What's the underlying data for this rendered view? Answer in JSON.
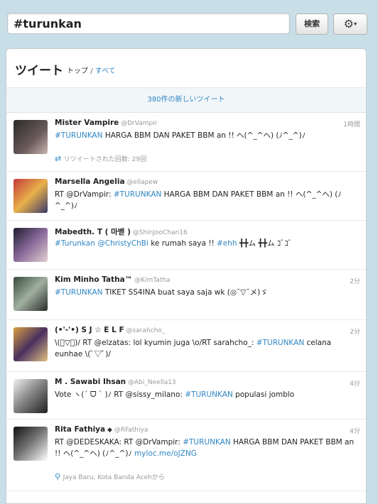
{
  "search": {
    "query": "#turunkan",
    "button_label": "検索",
    "gear": "⚙"
  },
  "panel": {
    "title": "ツイート",
    "tab_top": "トップ",
    "tab_separator": "/",
    "tab_all": "すべて",
    "new_tweets": "380件の新しいツイート"
  },
  "tweets": [
    {
      "name": "Mister Vampire",
      "handle": "@DrVampir",
      "time": "1時間",
      "parts": [
        [
          "#TURUNKAN",
          "hl"
        ],
        [
          " HARGA BBM DAN PAKET BBM an !! ヘ(^_^ヘ) (ﾉ^_^)ﾉ",
          ""
        ]
      ],
      "meta": "リツイートされた回数: 29回",
      "meta_icon": "retweet-icon"
    },
    {
      "name": "Marsella Angelia",
      "handle": "@ellapew",
      "time": "",
      "parts": [
        [
          "RT ",
          ""
        ],
        [
          "@DrVampir",
          ""
        ],
        [
          ": ",
          ""
        ],
        [
          "#TURUNKAN",
          "hl"
        ],
        [
          " HARGA BBM DAN PAKET BBM an !! ヘ(^_^ヘ) (ﾉ^_^)ﾉ",
          ""
        ]
      ]
    },
    {
      "name": "Mabedth. T ( 마벧 )",
      "handle": "@ShinJooChan16",
      "time": "",
      "parts": [
        [
          "#Turunkan",
          "hl"
        ],
        [
          " ",
          ""
        ],
        [
          "@ChristyChBi",
          "hl"
        ],
        [
          " ke rumah saya !! ",
          ""
        ],
        [
          "#ehh",
          "hl"
        ],
        [
          " ╋╋ム ╋╋ム ｺﾞｺﾞ",
          ""
        ]
      ]
    },
    {
      "name": "Kim Minho Tatha™",
      "handle": "@KimTatha",
      "time": "2分",
      "parts": [
        [
          "#TURUNKAN",
          "hl"
        ],
        [
          " TIKET SS4INA buat saya saja wk (◎¯▽¯メ)ゞ",
          ""
        ]
      ]
    },
    {
      "name": "(•'-'•) S J ☆ E L F",
      "handle": "@sarahcho_",
      "time": "2分",
      "parts": [
        [
          "\\(ﾟ▽ﾟ)/ RT ",
          ""
        ],
        [
          "@elzatas",
          ""
        ],
        [
          ": lol kyumin juga \\o/RT sarahcho_: ",
          ""
        ],
        [
          "#TURUNKAN",
          "hl"
        ],
        [
          " celana eunhae \\(ﾟ▽ﾟ)/",
          ""
        ]
      ]
    },
    {
      "name": "M . Sawabi Ihsan",
      "handle": "@Abi_Neella13",
      "time": "4分",
      "parts": [
        [
          "Vote ヽ(´ ᗜ ` )ﾉ RT ",
          ""
        ],
        [
          "@sissy_milano",
          ""
        ],
        [
          ": ",
          ""
        ],
        [
          "#TURUNKAN",
          "hl"
        ],
        [
          " populasi jomblo",
          ""
        ]
      ]
    },
    {
      "name": "Rita Fathiya",
      "handle": "@RFathiya",
      "time": "4分",
      "parts": [
        [
          "RT ",
          ""
        ],
        [
          "@DEDESKAKA",
          ""
        ],
        [
          ": RT ",
          ""
        ],
        [
          "@DrVampir",
          ""
        ],
        [
          ": ",
          ""
        ],
        [
          "#TURUNKAN",
          "hl"
        ],
        [
          " HARGA BBM DAN PAKET BBM an !! ヘ(^_^ヘ) (ﾉ^_^)ﾉ ",
          ""
        ],
        [
          "myloc.me/oJZNG",
          "hl"
        ]
      ],
      "meta": "Jaya Baru, Kota Banda Acehから",
      "meta_icon": "location-pin-icon"
    }
  ],
  "colors": {
    "link": "#2f86c4",
    "background": "#c9dfe8"
  }
}
